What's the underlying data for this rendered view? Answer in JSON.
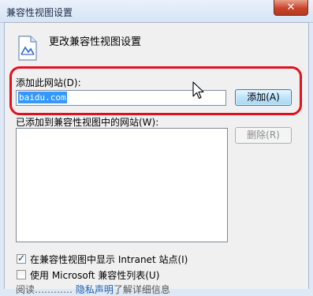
{
  "window": {
    "title": "兼容性视图设置",
    "close_symbol": "✕"
  },
  "header": {
    "text": "更改兼容性视图设置",
    "icon": "compat-view-icon"
  },
  "add_site": {
    "label": "添加此网站(D):",
    "value": "baidu.com",
    "button_label": "添加(A)"
  },
  "added_sites": {
    "label": "已添加到兼容性视图中的网站(W):",
    "items": [],
    "delete_button_label": "删除(R)"
  },
  "options": [
    {
      "label": "在兼容性视图中显示 Intranet 站点(I)",
      "checked": true
    },
    {
      "label": "使用 Microsoft 兼容性列表(U)",
      "checked": false
    }
  ],
  "partial_text": {
    "prefix": "阅读",
    "link": "隐私声明",
    "suffix": "了解详细信息"
  },
  "colors": {
    "highlight": "#e0111d",
    "selection": "#3399ff"
  }
}
